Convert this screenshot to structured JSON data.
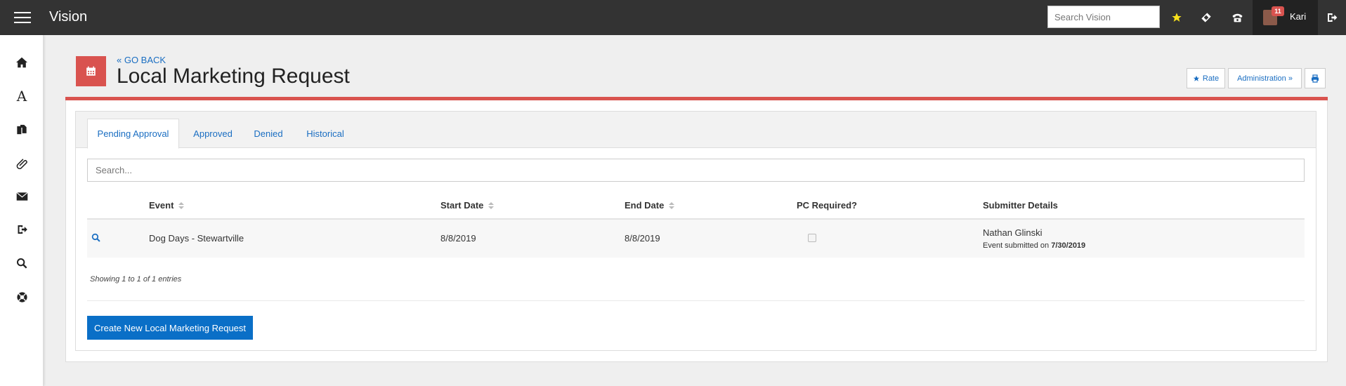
{
  "app": {
    "title": "Vision",
    "search_placeholder": "Search Vision"
  },
  "topbar": {
    "notification_count": "11",
    "user_name": "Kari",
    "icons": [
      "hamburger-menu-icon",
      "star-icon",
      "ticket-icon",
      "phone-icon",
      "logout-icon"
    ],
    "star_color": "#f7e01b"
  },
  "sidebar": {
    "icons": [
      "home-icon",
      "font-icon",
      "documents-icon",
      "paperclip-icon",
      "envelope-icon",
      "sign-out-icon",
      "search-icon",
      "life-ring-icon"
    ]
  },
  "page": {
    "go_back": "« GO BACK",
    "title": "Local Marketing Request",
    "icon": "calendar-icon",
    "accent_color": "#d9534f"
  },
  "header_buttons": {
    "rate": "Rate",
    "administration": "Administration »",
    "print_icon": "print-icon"
  },
  "tabs": [
    {
      "label": "Pending Approval",
      "active": true
    },
    {
      "label": "Approved",
      "active": false
    },
    {
      "label": "Denied",
      "active": false
    },
    {
      "label": "Historical",
      "active": false
    }
  ],
  "table": {
    "search_placeholder": "Search...",
    "columns": [
      "Event",
      "Start Date",
      "End Date",
      "PC Required?",
      "Submitter Details"
    ],
    "rows": [
      {
        "event": "Dog Days - Stewartville",
        "start_date": "8/8/2019",
        "end_date": "8/8/2019",
        "pc_required": false,
        "submitter_name": "Nathan Glinski",
        "submitted_prefix": "Event submitted on",
        "submitted_date": "7/30/2019"
      }
    ],
    "showing": "Showing 1 to 1 of 1 entries"
  },
  "create_button": "Create New Local Marketing Request",
  "link_color": "#1a6ec2",
  "primary_color": "#0a6fc7"
}
